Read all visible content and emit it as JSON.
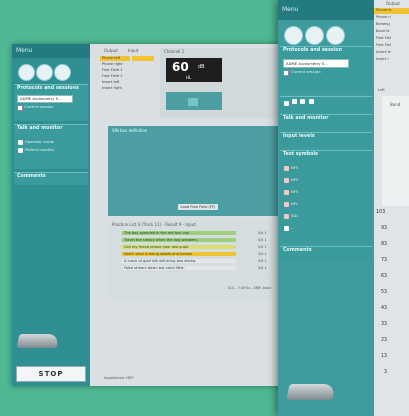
{
  "back_window": {
    "sidebar": {
      "menu_label": "Menu",
      "protocols_title": "Protocols and sessions",
      "protocol_dropdown": "ADME Audiometry S...",
      "current_session": "Current session",
      "talk_title": "Talk and monitor",
      "talk_items": [
        "Operator mode",
        "Patient monitor"
      ],
      "comments_title": "Comments",
      "stop_label": "STOP",
      "footer_text": "Impedance: HEP"
    },
    "header": {
      "output_label": "Output",
      "input_label": "Input",
      "output_items": [
        "Phone left",
        "Phone right",
        "Free Field 1",
        "Free Field 2",
        "Insert left",
        "Insert right"
      ],
      "channel_title": "Channel 1",
      "level_value": "60",
      "level_unit": "dB",
      "level_sub": "HL"
    },
    "main": {
      "definition_title": "SIN box definition",
      "definition_button": "Load Free Field (FF)",
      "list_header": "Practice List 4 (Track 11) - Result 9 - Input",
      "list_items": [
        "The boy sparkled in the red taxi van.",
        "Travel the sleepy when the dog wanders.",
        "Call my friend phone your law pupil.",
        "North wind is being stable and homes.",
        "A crack of gold silk will bring two sheep.",
        "False stream down but sand little."
      ],
      "list_scores": [
        "5/4 1",
        "5/4 1",
        "5/4 1",
        "5/4 1",
        "5/4 1",
        "5/4 1"
      ],
      "list_footer": "SLS - 7.50%s - SNR: basic"
    }
  },
  "front_window": {
    "sidebar": {
      "menu_label": "Menu",
      "protocols_title": "Protocols and session",
      "protocol_dropdown": "ADME Audiometry S...",
      "current_session": "Current session",
      "talk_title": "Talk and monitor",
      "input_levels_title": "Input levels",
      "test_symbols_title": "Test symbols",
      "test_symbols": [
        "NFS",
        "NFS",
        "NFS",
        "NFL",
        "SDL",
        "..."
      ],
      "comments_title": "Comments"
    },
    "main": {
      "output_tab": "Output",
      "output_items": [
        "Phone le",
        "Phone ri",
        "Boneng",
        "Bone le",
        "Free Fiel",
        "Free Fiel",
        "Insert le",
        "Insert r"
      ],
      "tab_label": "Left",
      "band_label": "Band",
      "y_ticks": [
        "103",
        "93",
        "83",
        "73",
        "63",
        "53",
        "43",
        "33",
        "23",
        "13",
        "3"
      ]
    }
  }
}
